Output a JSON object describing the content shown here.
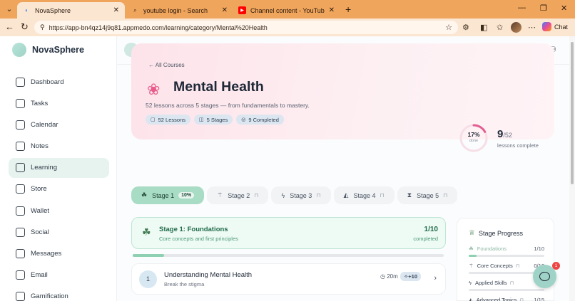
{
  "browser": {
    "tabs": [
      {
        "title": "NovaSphere",
        "active": true,
        "icon": "novasphere-favicon"
      },
      {
        "title": "youtube login - Search",
        "active": false,
        "icon": "search-icon"
      },
      {
        "title": "Channel content - YouTube Studio",
        "active": false,
        "icon": "youtube-icon"
      }
    ],
    "url": "https://app-bn4qz14j9q81.appmedo.com/learning/category/Mental%20Health",
    "copilot_label": "Chat"
  },
  "app": {
    "brand": "NovaSphere",
    "sidebar": [
      {
        "label": "Dashboard",
        "icon": "home-icon",
        "active": false
      },
      {
        "label": "Tasks",
        "icon": "checkbox-icon",
        "active": false
      },
      {
        "label": "Calendar",
        "icon": "calendar-icon",
        "active": false
      },
      {
        "label": "Notes",
        "icon": "notes-icon",
        "active": false
      },
      {
        "label": "Learning",
        "icon": "book-icon",
        "active": true
      },
      {
        "label": "Store",
        "icon": "store-icon",
        "active": false
      },
      {
        "label": "Wallet",
        "icon": "wallet-icon",
        "active": false
      },
      {
        "label": "Social",
        "icon": "users-icon",
        "active": false
      },
      {
        "label": "Messages",
        "icon": "message-icon",
        "active": false
      },
      {
        "label": "Email",
        "icon": "mail-icon",
        "active": false
      },
      {
        "label": "Gamification",
        "icon": "trophy-icon",
        "active": false
      }
    ]
  },
  "hero": {
    "back_label": "All Courses",
    "emoji": "❀",
    "title": "Mental Health",
    "description": "52 lessons across 5 stages — from fundamentals to mastery.",
    "chips": [
      {
        "icon": "▢",
        "label": "52 Lessons"
      },
      {
        "icon": "◫",
        "label": "5 Stages"
      },
      {
        "icon": "◎",
        "label": "9 Completed"
      }
    ],
    "progress_percent_label": "17%",
    "progress_fraction": 0.17,
    "progress_sub": "done",
    "completed": "9",
    "total": "/52",
    "completed_label": "lessons complete"
  },
  "stages": [
    {
      "label": "Stage 1",
      "icon": "☘",
      "badge": "10%",
      "active": true,
      "locked": false
    },
    {
      "label": "Stage 2",
      "icon": "⚚",
      "badge": "",
      "active": false,
      "locked": true
    },
    {
      "label": "Stage 3",
      "icon": "ϟ",
      "badge": "",
      "active": false,
      "locked": true
    },
    {
      "label": "Stage 4",
      "icon": "◭",
      "badge": "",
      "active": false,
      "locked": true
    },
    {
      "label": "Stage 5",
      "icon": "⧗",
      "badge": "",
      "active": false,
      "locked": true
    }
  ],
  "current_stage": {
    "title": "Stage 1: Foundations",
    "subtitle": "Core concepts and first principles",
    "count": "1/10",
    "count_label": "completed",
    "progress_fraction": 0.1
  },
  "lesson": {
    "number": "1",
    "title": "Understanding Mental Health",
    "subtitle": "Break the stigma",
    "duration": "20m",
    "xp": "+10"
  },
  "stage_progress": {
    "title": "Stage Progress",
    "rows": [
      {
        "name": "Foundations",
        "value": "1/10",
        "fraction": 0.1,
        "locked": false
      },
      {
        "name": "Core Concepts",
        "value": "0/10",
        "fraction": 0,
        "locked": true
      },
      {
        "name": "Applied Skills",
        "value": "0/",
        "fraction": 0,
        "locked": true
      },
      {
        "name": "Advanced Topics",
        "value": "1/15",
        "fraction": 0.066,
        "locked": true
      }
    ]
  },
  "chat_badge": "1"
}
